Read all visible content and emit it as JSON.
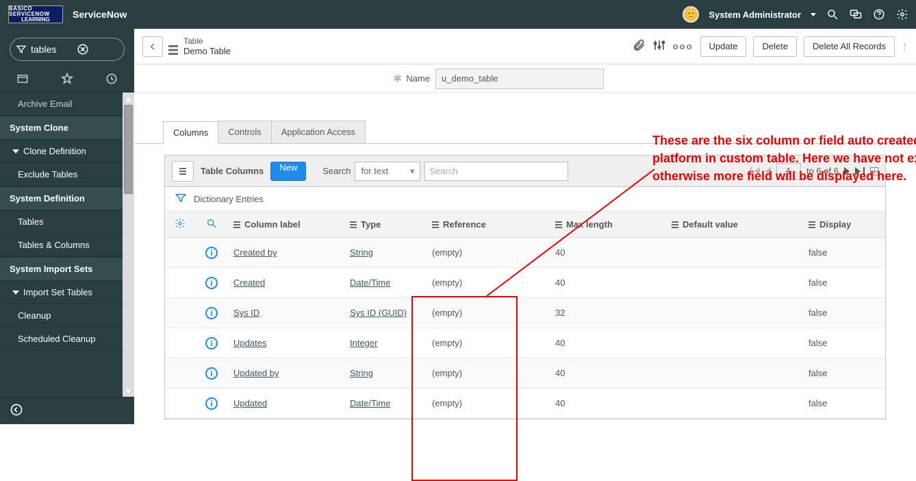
{
  "banner": {
    "logo_line1": "BASICO SERVICENOW",
    "logo_line2": "LEARNING",
    "brand": "ServiceNow",
    "user": "System Administrator"
  },
  "nav": {
    "filter_value": "tables",
    "truncated_top": "Archive Email",
    "sections": [
      {
        "title": "System Clone",
        "groups": [
          {
            "collapse_label": "Clone Definition",
            "items": [
              "Exclude Tables"
            ]
          }
        ]
      },
      {
        "title": "System Definition",
        "items": [
          "Tables",
          "Tables & Columns"
        ]
      },
      {
        "title": "System Import Sets",
        "groups": [
          {
            "collapse_label": "Import Set Tables",
            "items": [
              "Cleanup",
              "Scheduled Cleanup"
            ]
          }
        ]
      }
    ]
  },
  "form": {
    "title_small": "Table",
    "title_large": "Demo Table",
    "name_label": "Name",
    "name_value": "u_demo_table",
    "buttons": {
      "update": "Update",
      "delete": "Delete",
      "delete_all": "Delete All Records"
    }
  },
  "tabs": [
    "Columns",
    "Controls",
    "Application Access"
  ],
  "related_list": {
    "title": "Table Columns",
    "new_label": "New",
    "search_label": "Search",
    "search_mode": "for text",
    "search_placeholder": "Search",
    "pager": {
      "from": "1",
      "range": "to 6 of 6"
    },
    "breadcrumb": "Dictionary Entries",
    "columns": [
      "Column label",
      "Type",
      "Reference",
      "Max length",
      "Default value",
      "Display"
    ],
    "rows": [
      {
        "label": "Created by",
        "type": "String",
        "reference": "(empty)",
        "max": "40",
        "defv": "",
        "display": "false"
      },
      {
        "label": "Created",
        "type": "Date/Time",
        "reference": "(empty)",
        "max": "40",
        "defv": "",
        "display": "false"
      },
      {
        "label": "Sys ID",
        "type": "Sys ID (GUID)",
        "reference": "(empty)",
        "max": "32",
        "defv": "",
        "display": "false"
      },
      {
        "label": "Updates",
        "type": "Integer",
        "reference": "(empty)",
        "max": "40",
        "defv": "",
        "display": "false"
      },
      {
        "label": "Updated by",
        "type": "String",
        "reference": "(empty)",
        "max": "40",
        "defv": "",
        "display": "false"
      },
      {
        "label": "Updated",
        "type": "Date/Time",
        "reference": "(empty)",
        "max": "40",
        "defv": "",
        "display": "false"
      }
    ]
  },
  "annotation": "These are the six column or field auto created by service now platform in custom table. Here we have not extend any other table otherwise more field will be displayed here."
}
